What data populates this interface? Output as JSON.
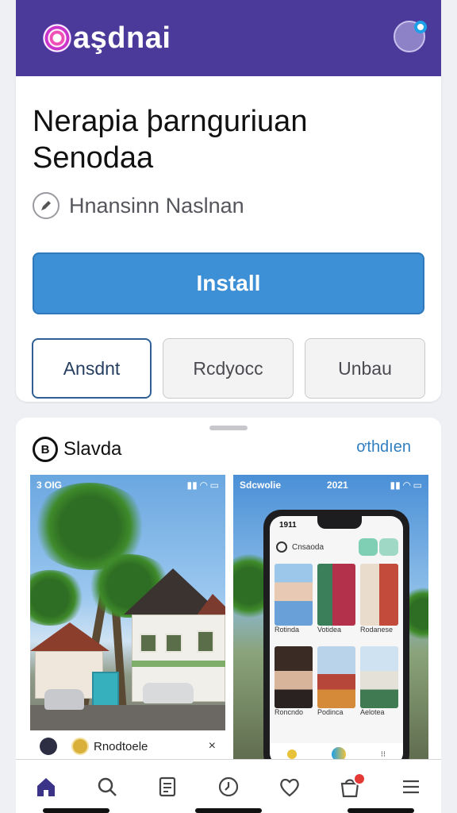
{
  "header": {
    "logo_text": "aşdnai",
    "brand_color": "#4b3a9a"
  },
  "app": {
    "title_line1": "Nerapia þarnguriuan",
    "title_line2": "Senodaa",
    "developer": "Hnansinn Naslnan",
    "install_label": "Install",
    "install_color": "#3d8fd6",
    "secondary_buttons": [
      "Ansdnt",
      "Rcdyocc",
      "Unbau"
    ]
  },
  "screenshots": {
    "title": "Slavda",
    "icon_letter": "B",
    "link": "ơthdıen",
    "shot1": {
      "status_left": "3 OIG",
      "bar_label": "Rnodtoele",
      "close": "×"
    },
    "shot2": {
      "status_left": "Sdcwolie",
      "status_center": "2021",
      "phone_time": "1911",
      "phone_header": "Cnsaoda",
      "labels": [
        "Rotinda",
        "Votidea",
        "Rodanese",
        "Roncndo",
        "Podinca",
        "Aelotea"
      ]
    }
  },
  "bottom_nav": {
    "items": [
      "home-icon",
      "search-icon",
      "document-icon",
      "history-icon",
      "heart-icon",
      "bag-icon",
      "menu-icon"
    ]
  }
}
